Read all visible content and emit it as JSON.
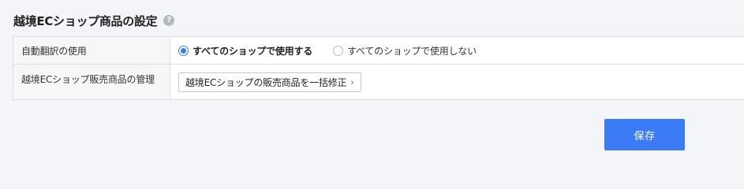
{
  "section": {
    "title": "越境ECショップ商品の設定",
    "help_icon": "?"
  },
  "rows": [
    {
      "label": "自動翻訳の使用",
      "options": [
        {
          "label": "すべてのショップで使用する",
          "checked": true
        },
        {
          "label": "すべてのショップで使用しない",
          "checked": false
        }
      ]
    },
    {
      "label": "越境ECショップ販売商品の管理",
      "button_label": "越境ECショップの販売商品を一括修正",
      "button_icon": "›"
    }
  ],
  "footer": {
    "save_label": "保存"
  },
  "colors": {
    "accent": "#3b7cf6",
    "page_bg": "#f4f5f8"
  }
}
